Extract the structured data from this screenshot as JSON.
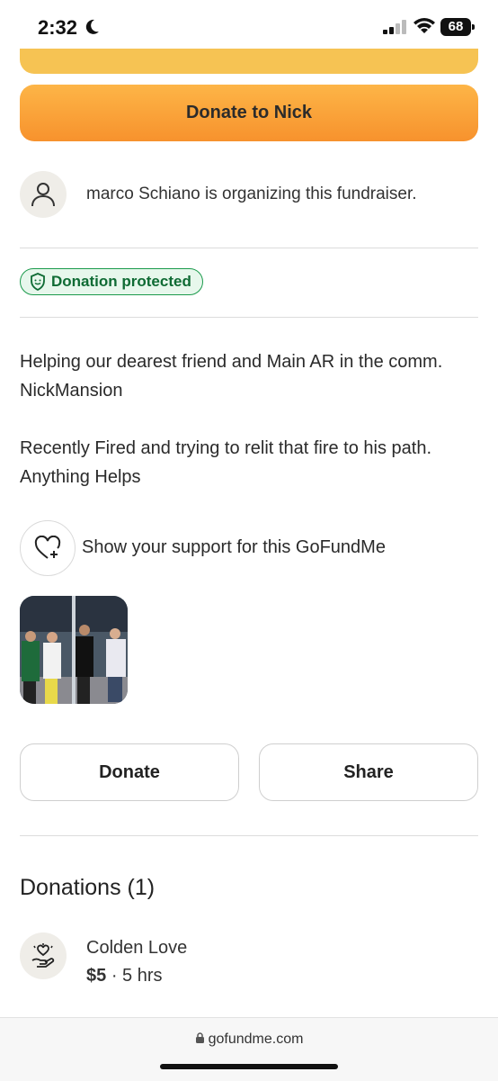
{
  "status_bar": {
    "time": "2:32",
    "battery": "68"
  },
  "cta": {
    "donate_label": "Donate to Nick"
  },
  "organizer": {
    "text": "marco Schiano is organizing this fundraiser."
  },
  "badge": {
    "label": "Donation protected"
  },
  "description": {
    "line1": "Helping our dearest friend and Main AR in the comm.",
    "line2": "NickMansion",
    "line3": "Recently Fired and trying to relit that fire to his path.",
    "line4": "Anything Helps"
  },
  "support": {
    "label": "Show your support for this GoFundMe"
  },
  "actions": {
    "donate_label": "Donate",
    "share_label": "Share"
  },
  "donations": {
    "title": "Donations (1)",
    "items": [
      {
        "name": "Colden Love",
        "amount": "$5",
        "time": "· 5 hrs"
      }
    ]
  },
  "browser": {
    "url": "gofundme.com"
  },
  "colors": {
    "accent_orange": "#f7922d",
    "protected_green": "#1b9a4c"
  }
}
